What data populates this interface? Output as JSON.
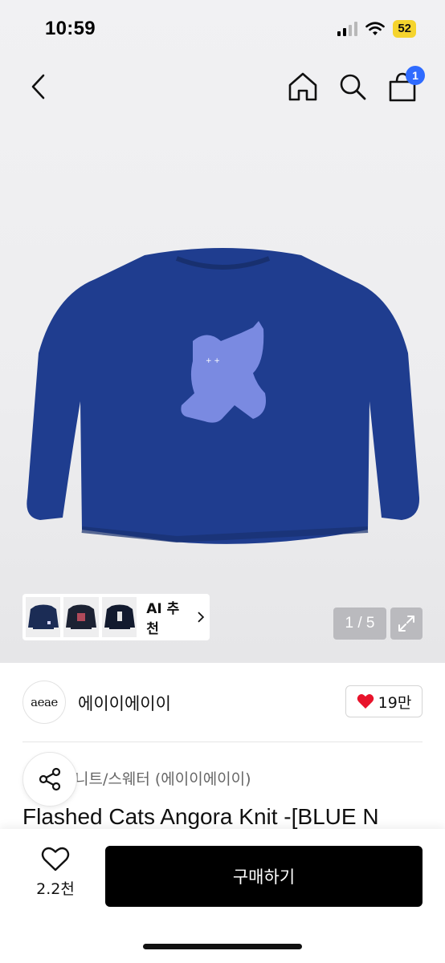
{
  "status_bar": {
    "time": "10:59",
    "battery": "52"
  },
  "nav": {
    "cart_count": "1"
  },
  "gallery": {
    "counter": "1 / 5",
    "ai_recommend_label": "AI 추천",
    "ai_thumbnail_count": 3
  },
  "brand": {
    "logo_text": "aeae",
    "name": "에이이에이이",
    "like_count": "19만"
  },
  "product": {
    "category": "니트/스웨터 (에이이에이이)",
    "title": "Flashed Cats Angora Knit -[BLUE N"
  },
  "bottom_bar": {
    "wish_count": "2.2천",
    "buy_label": "구매하기"
  },
  "colors": {
    "accent_badge": "#2f6bff",
    "heart": "#e8132b",
    "sweater": "#1f3d8f",
    "cat": "#7f8ee6"
  }
}
